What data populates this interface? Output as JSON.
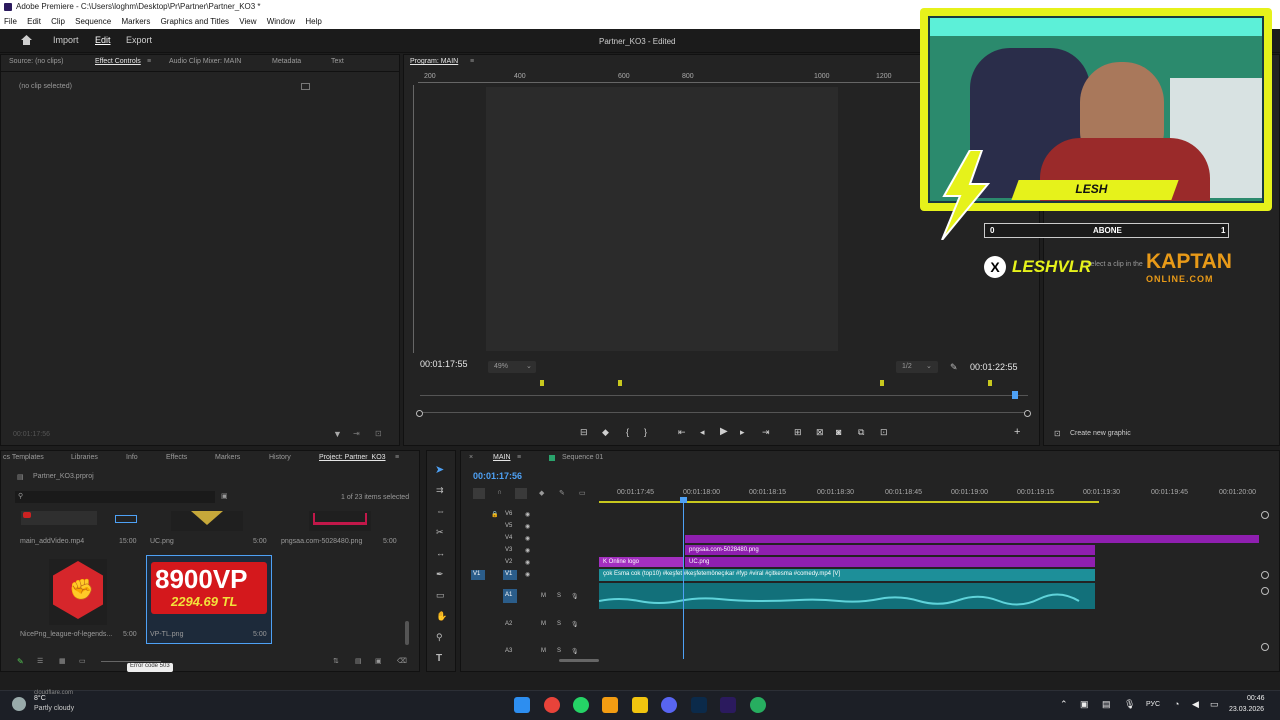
{
  "window": {
    "title": "Adobe Premiere - C:\\Users\\loghm\\Desktop\\Pr\\Partner\\Partner_KO3 *",
    "menus": [
      "File",
      "Edit",
      "Clip",
      "Sequence",
      "Markers",
      "Graphics and Titles",
      "View",
      "Window",
      "Help"
    ]
  },
  "header": {
    "nav": [
      "Import",
      "Edit",
      "Export"
    ],
    "project_title": "Partner_KO3 - Edited"
  },
  "source_panel": {
    "tabs": [
      "Source: (no clips)",
      "Effect Controls",
      "Audio Clip Mixer: MAIN",
      "Metadata",
      "Text"
    ],
    "message": "(no clip selected)",
    "timecode": "00:01:17:56"
  },
  "program_panel": {
    "title": "Program: MAIN",
    "ruler": [
      "200",
      "400",
      "600",
      "800",
      "1000",
      "1200"
    ],
    "timecode_left": "00:01:17:55",
    "zoom": "49%",
    "resolution": "1/2",
    "timecode_right": "00:01:22:55"
  },
  "overlay": {
    "streamer_name": "LESH",
    "abone_label": "ABONE",
    "abone_left": "0",
    "abone_right": "1",
    "social_handle": "LESHVLR",
    "brand_top": "KAPTAN",
    "brand_bottom": "ONLINE.COM",
    "behind_text": "Select a clip in the",
    "create_graphic": "Create new graphic"
  },
  "project_panel": {
    "tabs": [
      "cs Templates",
      "Libraries",
      "Info",
      "Effects",
      "Markers",
      "History",
      "Project: Partner_KO3"
    ],
    "file": "Partner_KO3.prproj",
    "count": "1 of 23 items selected",
    "items": [
      {
        "name": "main_addVideo.mp4",
        "duration": "15:00"
      },
      {
        "name": "UC.png",
        "duration": "5:00"
      },
      {
        "name": "pngsaa.com-5028480.png",
        "duration": "5:00"
      },
      {
        "name": "NicePng_league-of-legends...",
        "duration": "5:00"
      },
      {
        "name": "VP-TL.png",
        "duration": "5:00"
      }
    ],
    "vp_big": "8900VP",
    "vp_small": "2294.69 TL",
    "error": "Error code 503",
    "cloudflare": "cloudflare.com"
  },
  "timeline": {
    "tabs": [
      "MAIN",
      "Sequence 01"
    ],
    "timecode": "00:01:17:56",
    "ruler": [
      "00:01:17:45",
      "00:01:18:00",
      "00:01:18:15",
      "00:01:18:30",
      "00:01:18:45",
      "00:01:19:00",
      "00:01:19:15",
      "00:01:19:30",
      "00:01:19:45",
      "00:01:20:00"
    ],
    "video_tracks": [
      "V6",
      "V5",
      "V4",
      "V3",
      "V2",
      "V1"
    ],
    "audio_tracks": [
      "A1",
      "A2",
      "A3"
    ],
    "v1_patch": "V1",
    "a1_patch": "A1",
    "clips": {
      "v3": "pngsaa.com-5028480.png",
      "v2_left": "K Online logo",
      "v2_right": "UC.png",
      "v1": "çok Esma cok (top10) #keşfet #keşfetemöneçıkar #fyp #viral #çitkesma #comedy.mp4 [V]"
    }
  },
  "taskbar": {
    "weather_temp": "8°C",
    "weather_desc": "Partly cloudy",
    "lang": "РУС",
    "time": "00:46",
    "date": "23.03.2026"
  }
}
